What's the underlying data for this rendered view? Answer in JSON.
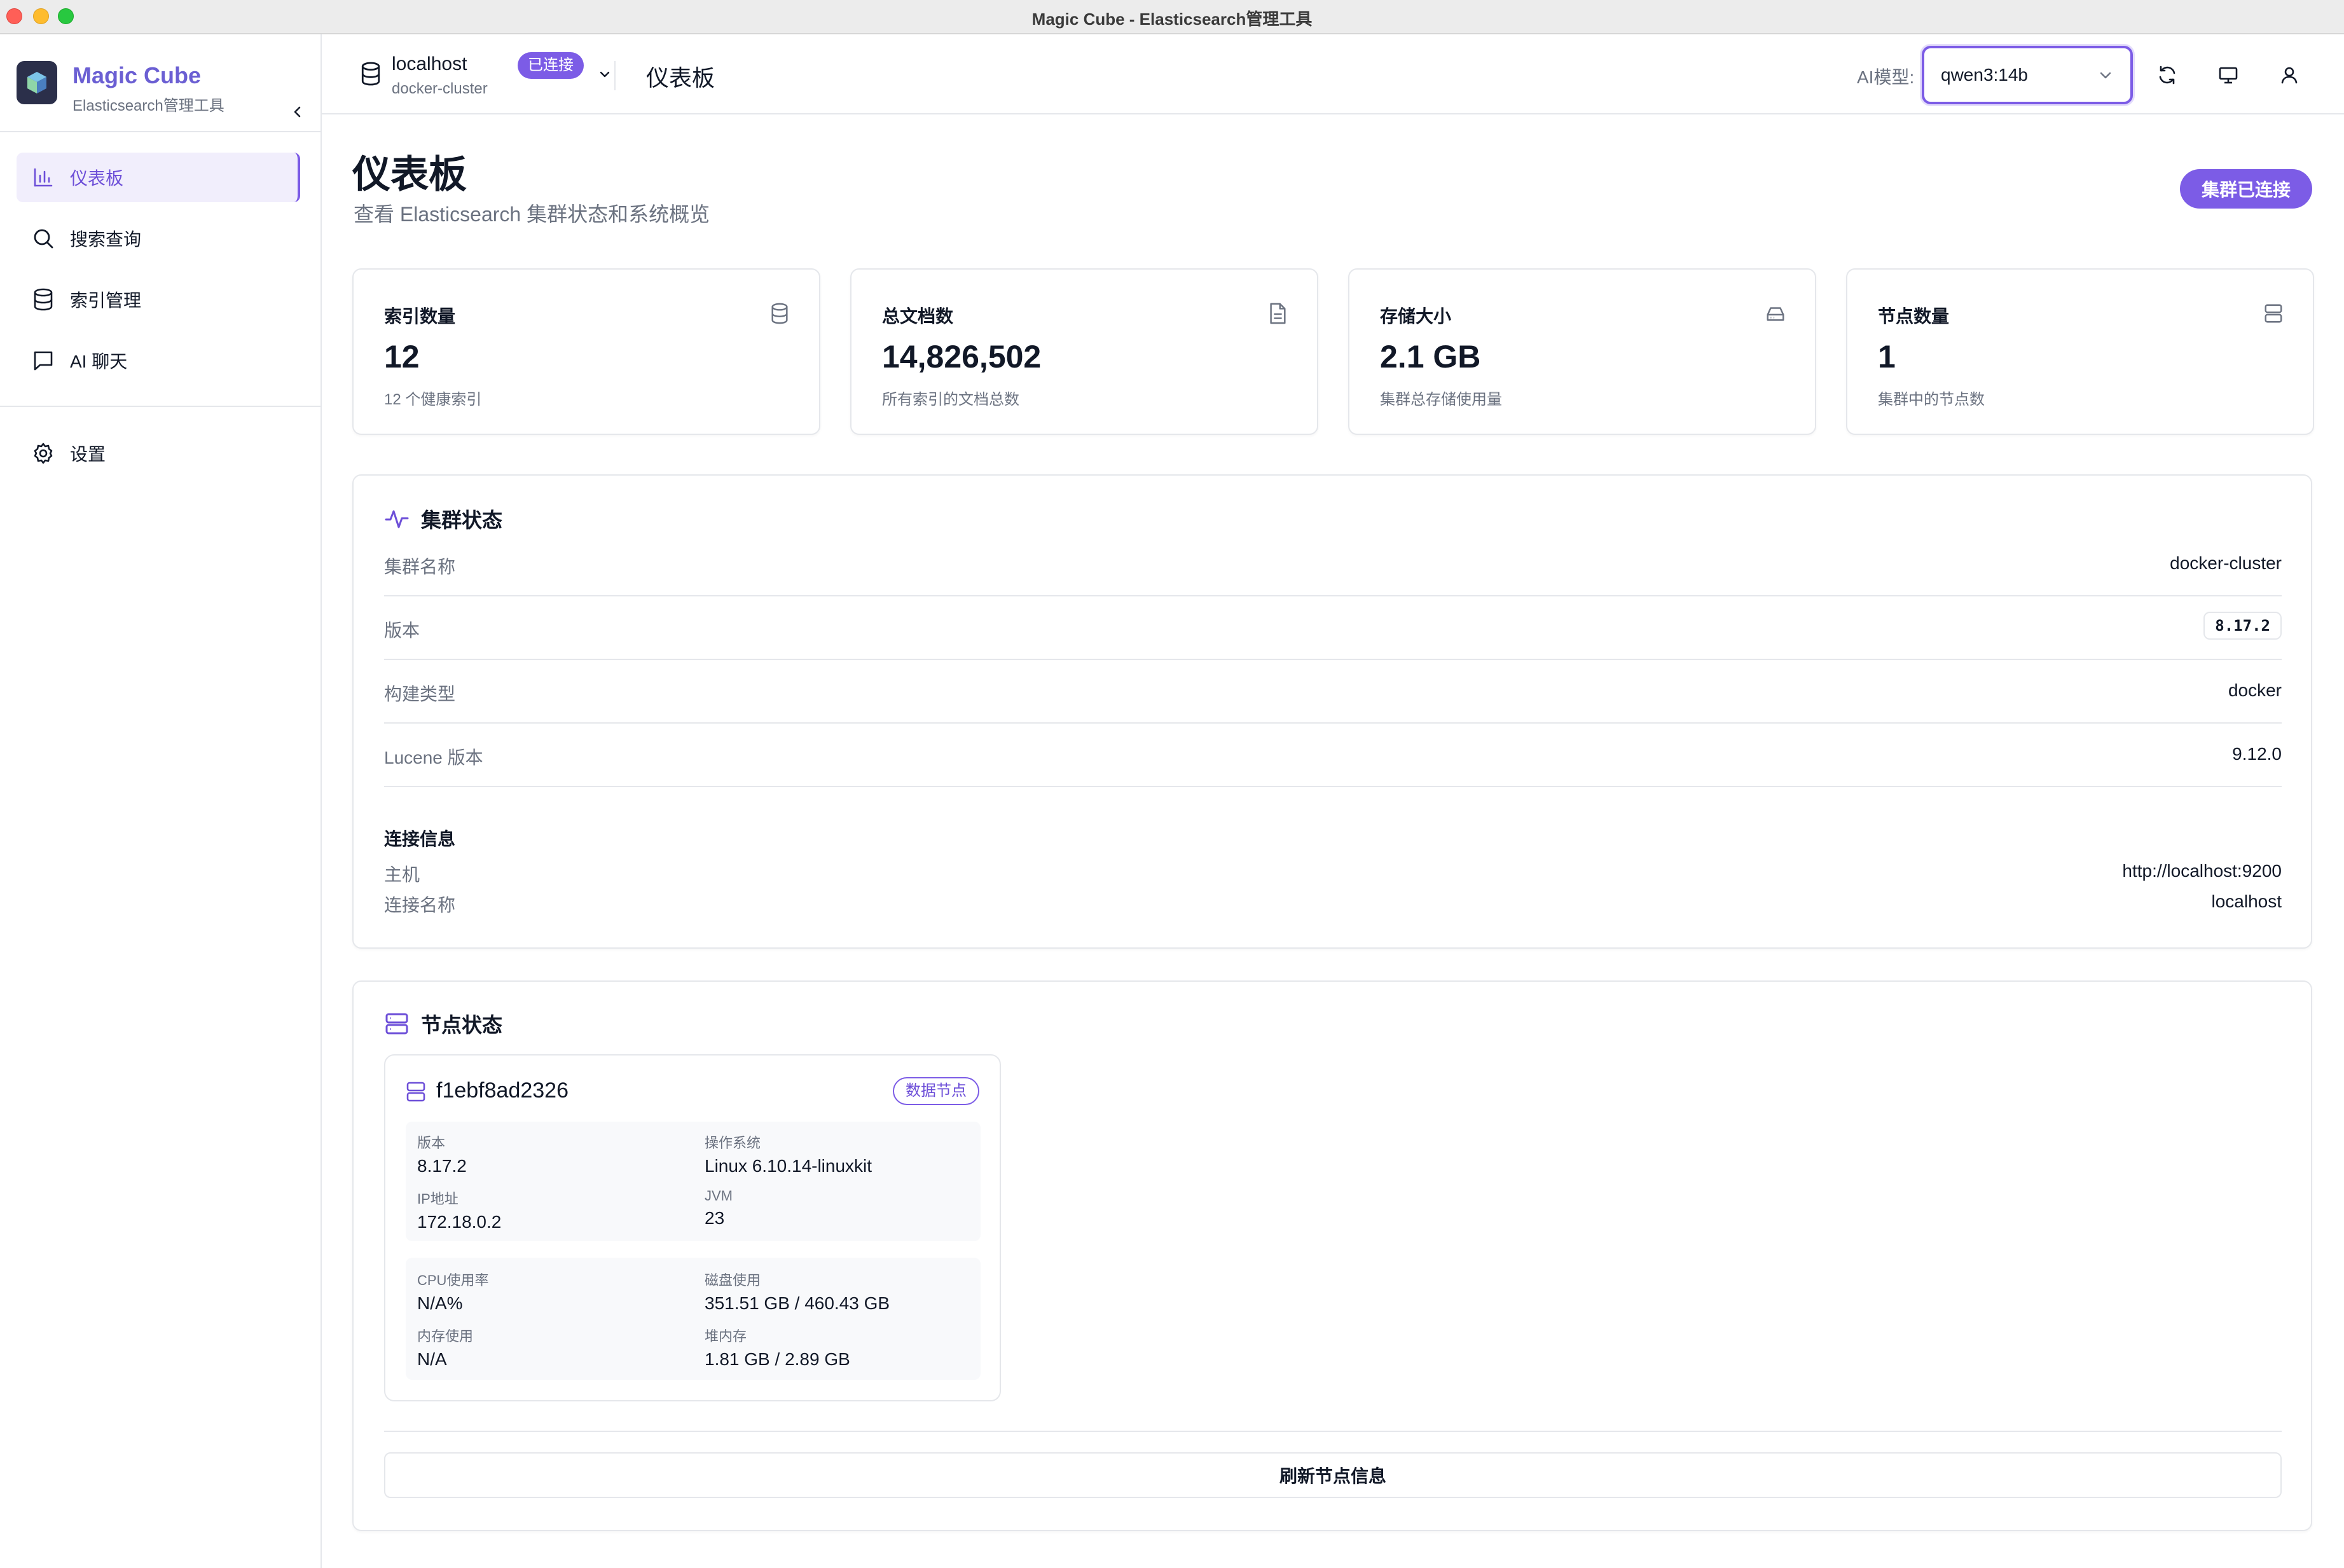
{
  "window": {
    "title": "Magic Cube - Elasticsearch管理工具"
  },
  "brand": {
    "name": "Magic Cube",
    "subtitle": "Elasticsearch管理工具"
  },
  "sidebar": {
    "items": [
      {
        "label": "仪表板",
        "icon": "bar-chart-icon",
        "active": true
      },
      {
        "label": "搜索查询",
        "icon": "search-icon"
      },
      {
        "label": "索引管理",
        "icon": "database-icon"
      },
      {
        "label": "AI 聊天",
        "icon": "chat-icon"
      },
      {
        "label": "设置",
        "icon": "gear-icon"
      }
    ]
  },
  "header": {
    "connection_host": "localhost",
    "connection_badge": "已连接",
    "connection_cluster": "docker-cluster",
    "title": "仪表板",
    "ai_label": "AI模型:",
    "ai_model": "qwen3:14b"
  },
  "page": {
    "title": "仪表板",
    "subtitle": "查看 Elasticsearch 集群状态和系统概览",
    "status_pill": "集群已连接"
  },
  "stats": [
    {
      "label": "索引数量",
      "value": "12",
      "sub": "12 个健康索引",
      "icon": "database-icon"
    },
    {
      "label": "总文档数",
      "value": "14,826,502",
      "sub": "所有索引的文档总数",
      "icon": "document-icon"
    },
    {
      "label": "存储大小",
      "value": "2.1 GB",
      "sub": "集群总存储使用量",
      "icon": "hard-drive-icon"
    },
    {
      "label": "节点数量",
      "value": "1",
      "sub": "集群中的节点数",
      "icon": "server-icon"
    }
  ],
  "cluster": {
    "title": "集群状态",
    "rows": [
      {
        "key": "集群名称",
        "value": "docker-cluster"
      },
      {
        "key": "版本",
        "value": "8.17.2"
      },
      {
        "key": "构建类型",
        "value": "docker"
      },
      {
        "key": "Lucene 版本",
        "value": "9.12.0"
      }
    ],
    "connection_title": "连接信息",
    "connection_rows": [
      {
        "key": "主机",
        "value": "http://localhost:9200"
      },
      {
        "key": "连接名称",
        "value": "localhost"
      }
    ]
  },
  "nodes": {
    "title": "节点状态",
    "node": {
      "name": "f1ebf8ad2326",
      "badge": "数据节点",
      "info": [
        {
          "key": "版本",
          "value": "8.17.2"
        },
        {
          "key": "操作系统",
          "value": "Linux 6.10.14-linuxkit"
        },
        {
          "key": "IP地址",
          "value": "172.18.0.2"
        },
        {
          "key": "JVM",
          "value": "23"
        }
      ],
      "usage": [
        {
          "key": "CPU使用率",
          "value": "N/A%"
        },
        {
          "key": "磁盘使用",
          "value": "351.51 GB / 460.43 GB"
        },
        {
          "key": "内存使用",
          "value": "N/A"
        },
        {
          "key": "堆内存",
          "value": "1.81 GB / 2.89 GB"
        }
      ]
    },
    "refresh_label": "刷新节点信息"
  },
  "colors": {
    "accent": "#7c5ce6",
    "accent_dark": "#6d4fd8",
    "border": "#e5e7eb",
    "muted": "#6b7280"
  }
}
